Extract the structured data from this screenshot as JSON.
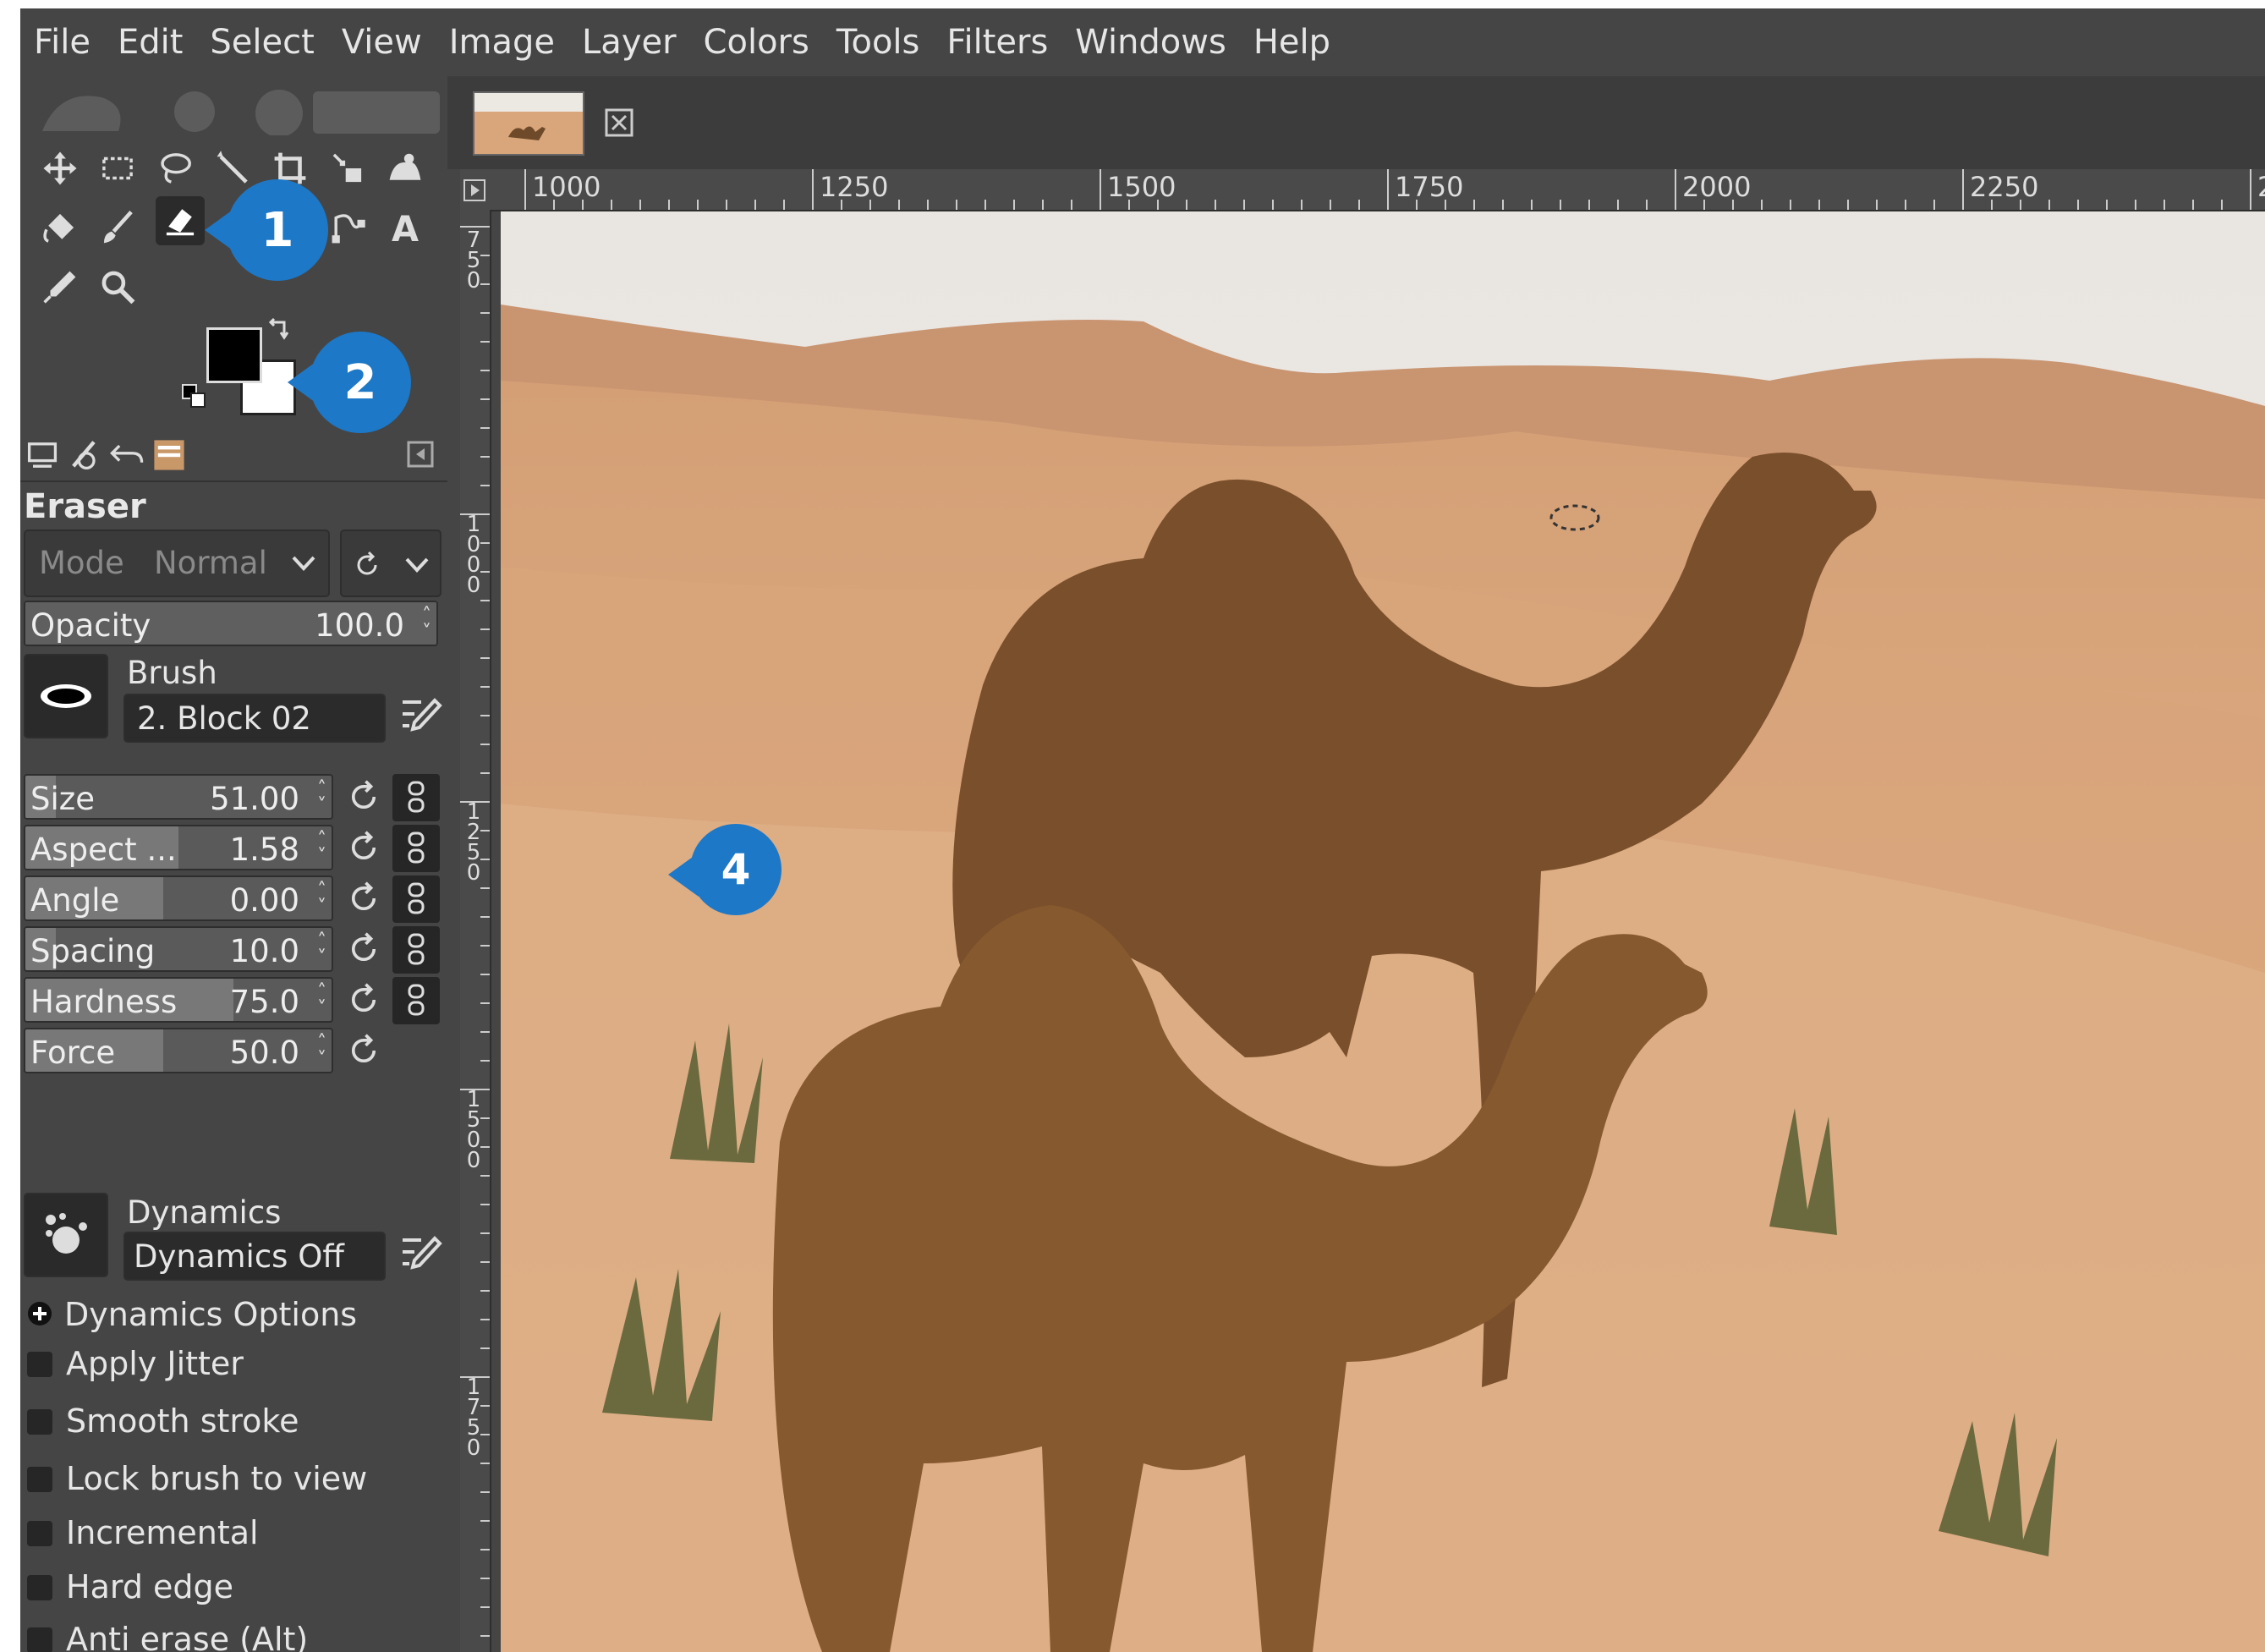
{
  "menu": [
    "File",
    "Edit",
    "Select",
    "View",
    "Image",
    "Layer",
    "Colors",
    "Tools",
    "Filters",
    "Windows",
    "Help"
  ],
  "tools": {
    "row1": [
      "move-icon",
      "rect-select-icon",
      "lasso-icon",
      "fuzzy-select-icon",
      "crop-icon",
      "transform-icon",
      "warp-icon"
    ],
    "row2": [
      "bucket-fill-icon",
      "paintbrush-icon",
      "eraser-icon",
      "clone-icon",
      "smudge-icon",
      "paths-icon",
      "text-icon"
    ],
    "row3": [
      "color-picker-icon",
      "zoom-icon"
    ],
    "active": "eraser-icon"
  },
  "callouts": {
    "c1": "1",
    "c2": "2",
    "c4": "4"
  },
  "colors": {
    "foreground": "#000000",
    "background": "#ffffff",
    "accent": "#1d78c7"
  },
  "tool_options": {
    "title": "Eraser",
    "mode_label": "Mode",
    "mode_value": "Normal",
    "opacity": {
      "label": "Opacity",
      "value": "100.0"
    },
    "brush": {
      "label": "Brush",
      "value": "2. Block 02"
    },
    "sliders": [
      {
        "label": "Size",
        "value": "51.00",
        "fill": 0.1
      },
      {
        "label": "Aspect ...",
        "value": "1.58",
        "fill": 0.5
      },
      {
        "label": "Angle",
        "value": "0.00",
        "fill": 0.45
      },
      {
        "label": "Spacing",
        "value": "10.0",
        "fill": 0.1
      },
      {
        "label": "Hardness",
        "value": "75.0",
        "fill": 0.68
      },
      {
        "label": "Force",
        "value": "50.0",
        "fill": 0.45
      }
    ],
    "dynamics": {
      "label": "Dynamics",
      "value": "Dynamics Off"
    },
    "dynamics_options": "Dynamics Options",
    "checkboxes": [
      "Apply Jitter",
      "Smooth stroke",
      "Lock brush to view",
      "Incremental",
      "Hard edge",
      "Anti erase  (Alt)"
    ]
  },
  "ruler": {
    "top": [
      "1000",
      "1250",
      "1500",
      "1750",
      "2000",
      "2250",
      "2"
    ],
    "left": [
      "750",
      "1000",
      "1250",
      "1500",
      "1750"
    ]
  }
}
